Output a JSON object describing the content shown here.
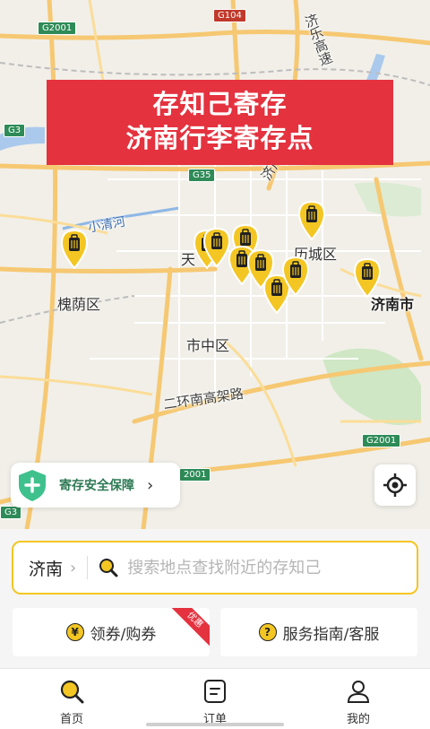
{
  "banner": {
    "line1": "存知己寄存",
    "line2": "济南行李寄存点"
  },
  "map": {
    "districts": {
      "lixia": "历城区",
      "huaiyin": "槐荫区",
      "shizhong": "市中区",
      "jinan_city": "济南市",
      "tian": "天"
    },
    "water": "小清河",
    "roads": {
      "ring_south": "二环南高架路",
      "jile": "济乐高速",
      "jiguang": "济广"
    },
    "shields": {
      "g2001_top": "G2001",
      "g104": "G104",
      "g3": "G3",
      "g35": "G35",
      "g2001_right": "G2001",
      "g2001_bottom": "2001",
      "g3_bottom": "G3"
    },
    "pin_count": 11,
    "colors": {
      "pin_fill": "#f3c623",
      "pin_dark": "#222222"
    }
  },
  "safety": {
    "label": "寄存安全保障",
    "chevron": "›"
  },
  "search": {
    "city": "济南",
    "chevron": "›",
    "placeholder": "搜索地点查找附近的存知己"
  },
  "actions": {
    "coupon": {
      "icon_glyph": "¥",
      "label": "领券/购券",
      "ribbon": "优惠"
    },
    "guide": {
      "icon_glyph": "?",
      "label": "服务指南/客服"
    }
  },
  "tabs": [
    {
      "label": "首页",
      "icon": "search-icon"
    },
    {
      "label": "订单",
      "icon": "order-icon"
    },
    {
      "label": "我的",
      "icon": "user-icon"
    }
  ],
  "colors": {
    "accent": "#f3c623",
    "banner_red": "#e4323f",
    "safety_green": "#3ec18d"
  }
}
